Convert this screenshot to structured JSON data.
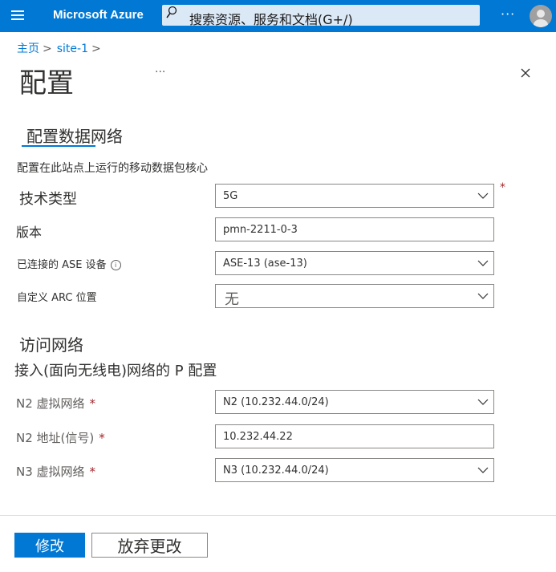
{
  "header": {
    "brand": "Microsoft Azure",
    "search_placeholder": "搜索资源、服务和文档(G+/)",
    "more": "···"
  },
  "breadcrumb": {
    "home": "主页",
    "site": "site-1"
  },
  "page": {
    "title": "配置",
    "more": "···"
  },
  "tab": {
    "label": "配置数据网络"
  },
  "description": "配置在此站点上运行的移动数据包核心",
  "fields": {
    "tech_type": {
      "label": "技术类型",
      "value": "5G"
    },
    "version": {
      "label": "版本",
      "value": "pmn-2211-0-3"
    },
    "ase_device": {
      "label": "已连接的 ASE 设备",
      "value": "ASE-13 (ase-13)"
    },
    "arc_location": {
      "label": "自定义 ARC 位置",
      "value": "无"
    }
  },
  "access_network": {
    "title": "访问网络",
    "subtitle": "接入(面向无线电)网络的 P 配置",
    "n2_vnet": {
      "label": "N2 虚拟网络",
      "value": "N2 (10.232.44.0/24)"
    },
    "n2_address": {
      "label": "N2 地址(信号)",
      "value": "10.232.44.22"
    },
    "n3_vnet": {
      "label": "N3 虚拟网络",
      "value": "N3 (10.232.44.0/24)"
    }
  },
  "required_mark": "*",
  "info_glyph": "i",
  "buttons": {
    "modify": "修改",
    "discard": "放弃更改"
  },
  "colors": {
    "accent": "#0078d4",
    "required": "#a4262c"
  }
}
